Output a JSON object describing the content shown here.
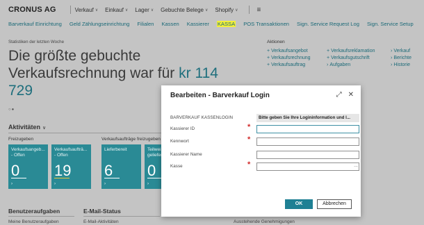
{
  "topbar": {
    "company": "CRONUS AG",
    "nav": [
      {
        "label": "Verkauf",
        "has_dropdown": true
      },
      {
        "label": "Einkauf",
        "has_dropdown": true
      },
      {
        "label": "Lager",
        "has_dropdown": true
      },
      {
        "label": "Gebuchte Belege",
        "has_dropdown": true
      },
      {
        "label": "Shopify",
        "has_dropdown": true
      }
    ],
    "menu_icon": "hamburger-icon"
  },
  "subnav": [
    "Barverkauf Einrichtung",
    "Geld Zählungseinrichtung",
    "Filialen",
    "Kassen",
    "Kassierer",
    "KASSA",
    "POS Transaktionen",
    "Sign. Service Request Log",
    "Sign. Service Setup"
  ],
  "highlight_color": "#f3ef3a",
  "statistics": {
    "caption": "Statistiken der letzten Woche",
    "headline_text": "Die größte gebuchte Verkaufsrechnung war für ",
    "headline_accent": "kr 114 729"
  },
  "actions": {
    "title": "Aktionen",
    "col1": [
      "Verkaufsangebot",
      "Verkaufsrechnung",
      "Verkaufsauftrag"
    ],
    "col2": [
      "Verkaufsreklamation",
      "Verkaufsgutschrift",
      "Aufgaben"
    ],
    "col3": [
      "Verkauf",
      "Berichte",
      "Historie"
    ]
  },
  "activities": {
    "title": "Aktivitäten",
    "group1": "Freizugeben",
    "group2": "Verkaufsaufträge freizugeben",
    "tiles": [
      {
        "label": "Verkaufsangeb... - Offen",
        "value": "0",
        "bar": "white"
      },
      {
        "label": "Verkaufsaufträ... - Offen",
        "value": "19",
        "bar": "gold"
      },
      {
        "label": "Lieferbereit",
        "value": "6",
        "bar": "white"
      },
      {
        "label": "Teilweise geliefert",
        "value": "0",
        "bar": "white"
      }
    ]
  },
  "bottom": {
    "sec1_title": "Benutzeraufgaben",
    "sec1_sub": "Meine Benutzeraufgaben",
    "sec2_title": "E-Mail-Status",
    "sec2_sub": "E-Mail-Aktivitäten",
    "sec3_sub": "Ausstehende Genehmigungen"
  },
  "modal": {
    "title": "Bearbeiten - Barverkauf Login",
    "fields": [
      {
        "label": "BARVERKAUF KASSENLOGIN",
        "value": "Bitte geben Sie Ihre Logininformation und l...",
        "readonly": true,
        "required": false
      },
      {
        "label": "Kassierer ID",
        "value": "",
        "readonly": false,
        "required": true
      },
      {
        "label": "Kennwort",
        "value": "",
        "readonly": false,
        "required": true
      },
      {
        "label": "Kassierer Name",
        "value": "",
        "readonly": false,
        "required": false
      },
      {
        "label": "Kasse",
        "value": "",
        "readonly": false,
        "required": true,
        "lookup": "..."
      }
    ],
    "required_marker": "*",
    "ok_label": "OK",
    "cancel_label": "Abbrechen",
    "accent_color": "#1f8094"
  }
}
